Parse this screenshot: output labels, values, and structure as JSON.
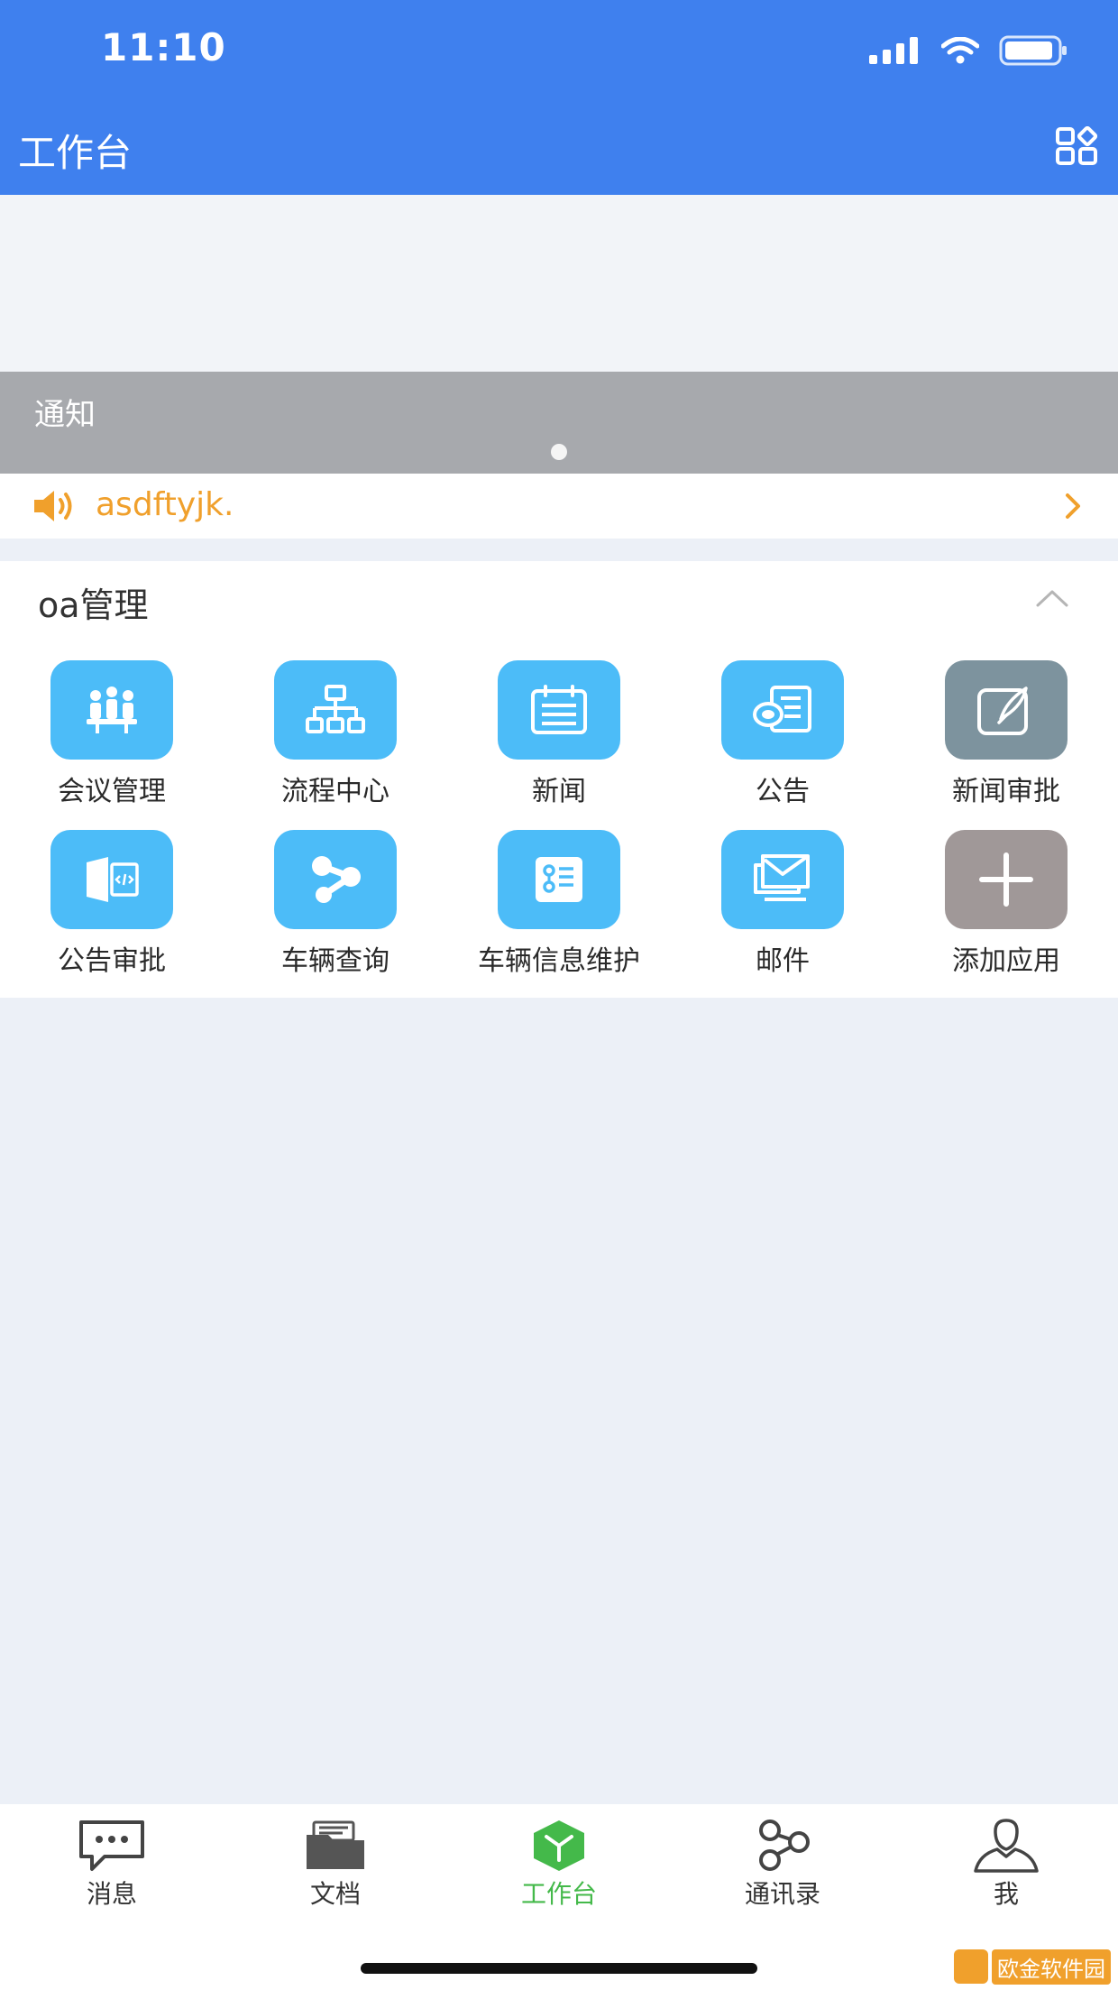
{
  "status_bar": {
    "time": "11:10"
  },
  "header": {
    "title": "工作台"
  },
  "banner": {
    "caption": "通知"
  },
  "notice": {
    "text": "asdftyjk."
  },
  "oa": {
    "title": "oa管理",
    "apps": [
      {
        "label": "会议管理",
        "icon": "meeting-icon",
        "color": "#4cbcf8"
      },
      {
        "label": "流程中心",
        "icon": "workflow-icon",
        "color": "#4cbcf8"
      },
      {
        "label": "新闻",
        "icon": "news-icon",
        "color": "#4cbcf8"
      },
      {
        "label": "公告",
        "icon": "announcement-icon",
        "color": "#4cbcf8"
      },
      {
        "label": "新闻审批",
        "icon": "news-approval-icon",
        "color": "#7d939e"
      },
      {
        "label": "公告审批",
        "icon": "announcement-approval-icon",
        "color": "#4cbcf8"
      },
      {
        "label": "车辆查询",
        "icon": "vehicle-query-icon",
        "color": "#4cbcf8"
      },
      {
        "label": "车辆信息维护",
        "icon": "vehicle-info-icon",
        "color": "#4cbcf8"
      },
      {
        "label": "邮件",
        "icon": "mail-icon",
        "color": "#4cbcf8"
      },
      {
        "label": "添加应用",
        "icon": "add-app-icon",
        "color": "#a09898"
      }
    ]
  },
  "tabs": [
    {
      "label": "消息",
      "icon": "message-icon"
    },
    {
      "label": "文档",
      "icon": "document-icon"
    },
    {
      "label": "工作台",
      "icon": "workbench-icon",
      "active": true
    },
    {
      "label": "通讯录",
      "icon": "contacts-icon"
    },
    {
      "label": "我",
      "icon": "profile-icon"
    }
  ],
  "colors": {
    "header": "#3f80ee",
    "app_tile": "#4cbcf8",
    "notice_text": "#f0a02c",
    "active_tab": "#44b94a"
  },
  "watermark": {
    "text": "欧金软件园"
  }
}
